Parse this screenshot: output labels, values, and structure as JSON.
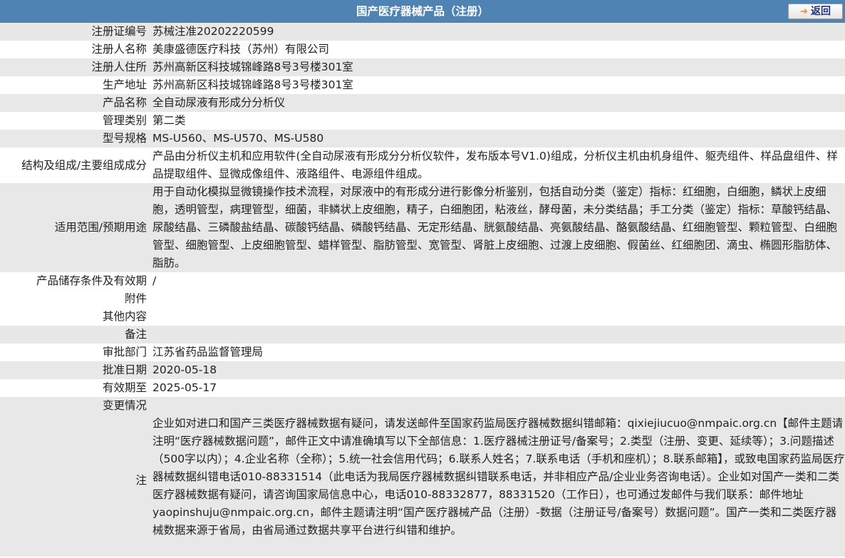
{
  "header": {
    "title": "国产医疗器械产品（注册）",
    "back_label": "返回",
    "back_icon": "arrow-right-icon"
  },
  "rows": [
    {
      "label": "注册证编号",
      "value": "苏械注准20202220599"
    },
    {
      "label": "注册人名称",
      "value": "美康盛德医疗科技（苏州）有限公司"
    },
    {
      "label": "注册人住所",
      "value": "苏州高新区科技城锦峰路8号3号楼301室"
    },
    {
      "label": "生产地址",
      "value": "苏州高新区科技城锦峰路8号3号楼301室"
    },
    {
      "label": "产品名称",
      "value": "全自动尿液有形成分分析仪"
    },
    {
      "label": "管理类别",
      "value": "第二类"
    },
    {
      "label": "型号规格",
      "value": "MS-U560、MS-U570、MS-U580"
    },
    {
      "label": "结构及组成/主要组成成分",
      "value": "产品由分析仪主机和应用软件(全自动尿液有形成分分析仪软件，发布版本号V1.0)组成，分析仪主机由机身组件、躯壳组件、样品盘组件、样品提取组件、显微成像组件、液路组件、电源组件组成。"
    },
    {
      "label": "适用范围/预期用途",
      "value": "用于自动化模拟显微镜操作技术流程，对尿液中的有形成分进行影像分析鉴别，包括自动分类（鉴定）指标：红细胞，白细胞，鳞状上皮细胞，透明管型，病理管型，细菌，非鳞状上皮细胞，精子，白细胞团，粘液丝，酵母菌，未分类结晶；手工分类（鉴定）指标：草酸钙结晶、尿酸结晶、三磷酸盐结晶、碳酸钙结晶、磷酸钙结晶、无定形结晶、胱氨酸结晶、亮氨酸结晶、酪氨酸结晶、红细胞管型、颗粒管型、白细胞管型、细胞管型、上皮细胞管型、蜡样管型、脂肪管型、宽管型、肾脏上皮细胞、过渡上皮细胞、假菌丝、红细胞团、滴虫、椭圆形脂肪体、脂肪。"
    },
    {
      "label": "产品储存条件及有效期",
      "value": "/"
    },
    {
      "label": "附件",
      "value": ""
    },
    {
      "label": "其他内容",
      "value": ""
    },
    {
      "label": "备注",
      "value": ""
    },
    {
      "label": "审批部门",
      "value": "江苏省药品监督管理局"
    },
    {
      "label": "批准日期",
      "value": "2020-05-18"
    },
    {
      "label": "有效期至",
      "value": "2025-05-17"
    },
    {
      "label": "变更情况",
      "value": ""
    }
  ],
  "note": {
    "label": "注",
    "text": "企业如对进口和国产三类医疗器械数据有疑问，请发送邮件至国家药监局医疗器械数据纠错邮箱：qixiejiucuo@nmpaic.org.cn【邮件主题请注明“医疗器械数据问题”，邮件正文中请准确填写以下全部信息：1.医疗器械注册证号/备案号；2.类型（注册、变更、延续等）；3.问题描述（500字以内）；4.企业名称（全称）；5.统一社会信用代码；6.联系人姓名；7.联系电话（手机和座机）；8.联系邮箱】，或致电国家药监局医疗器械数据纠错电话010-88331514（此电话为我局医疗器械数据纠错联系电话，并非相应产品/企业业务咨询电话）。企业如对国产一类和二类医疗器械数据有疑问，请咨询国家局信息中心，电话010-88332877，88331520（工作日），也可通过发邮件与我们联系：邮件地址yaopinshuju@nmpaic.org.cn，邮件主题请注明“国产医疗器械产品（注册）-数据（注册证号/备案号）数据问题”。国产一类和二类医疗器械数据来源于省局，由省局通过数据共享平台进行纠错和维护。"
  }
}
